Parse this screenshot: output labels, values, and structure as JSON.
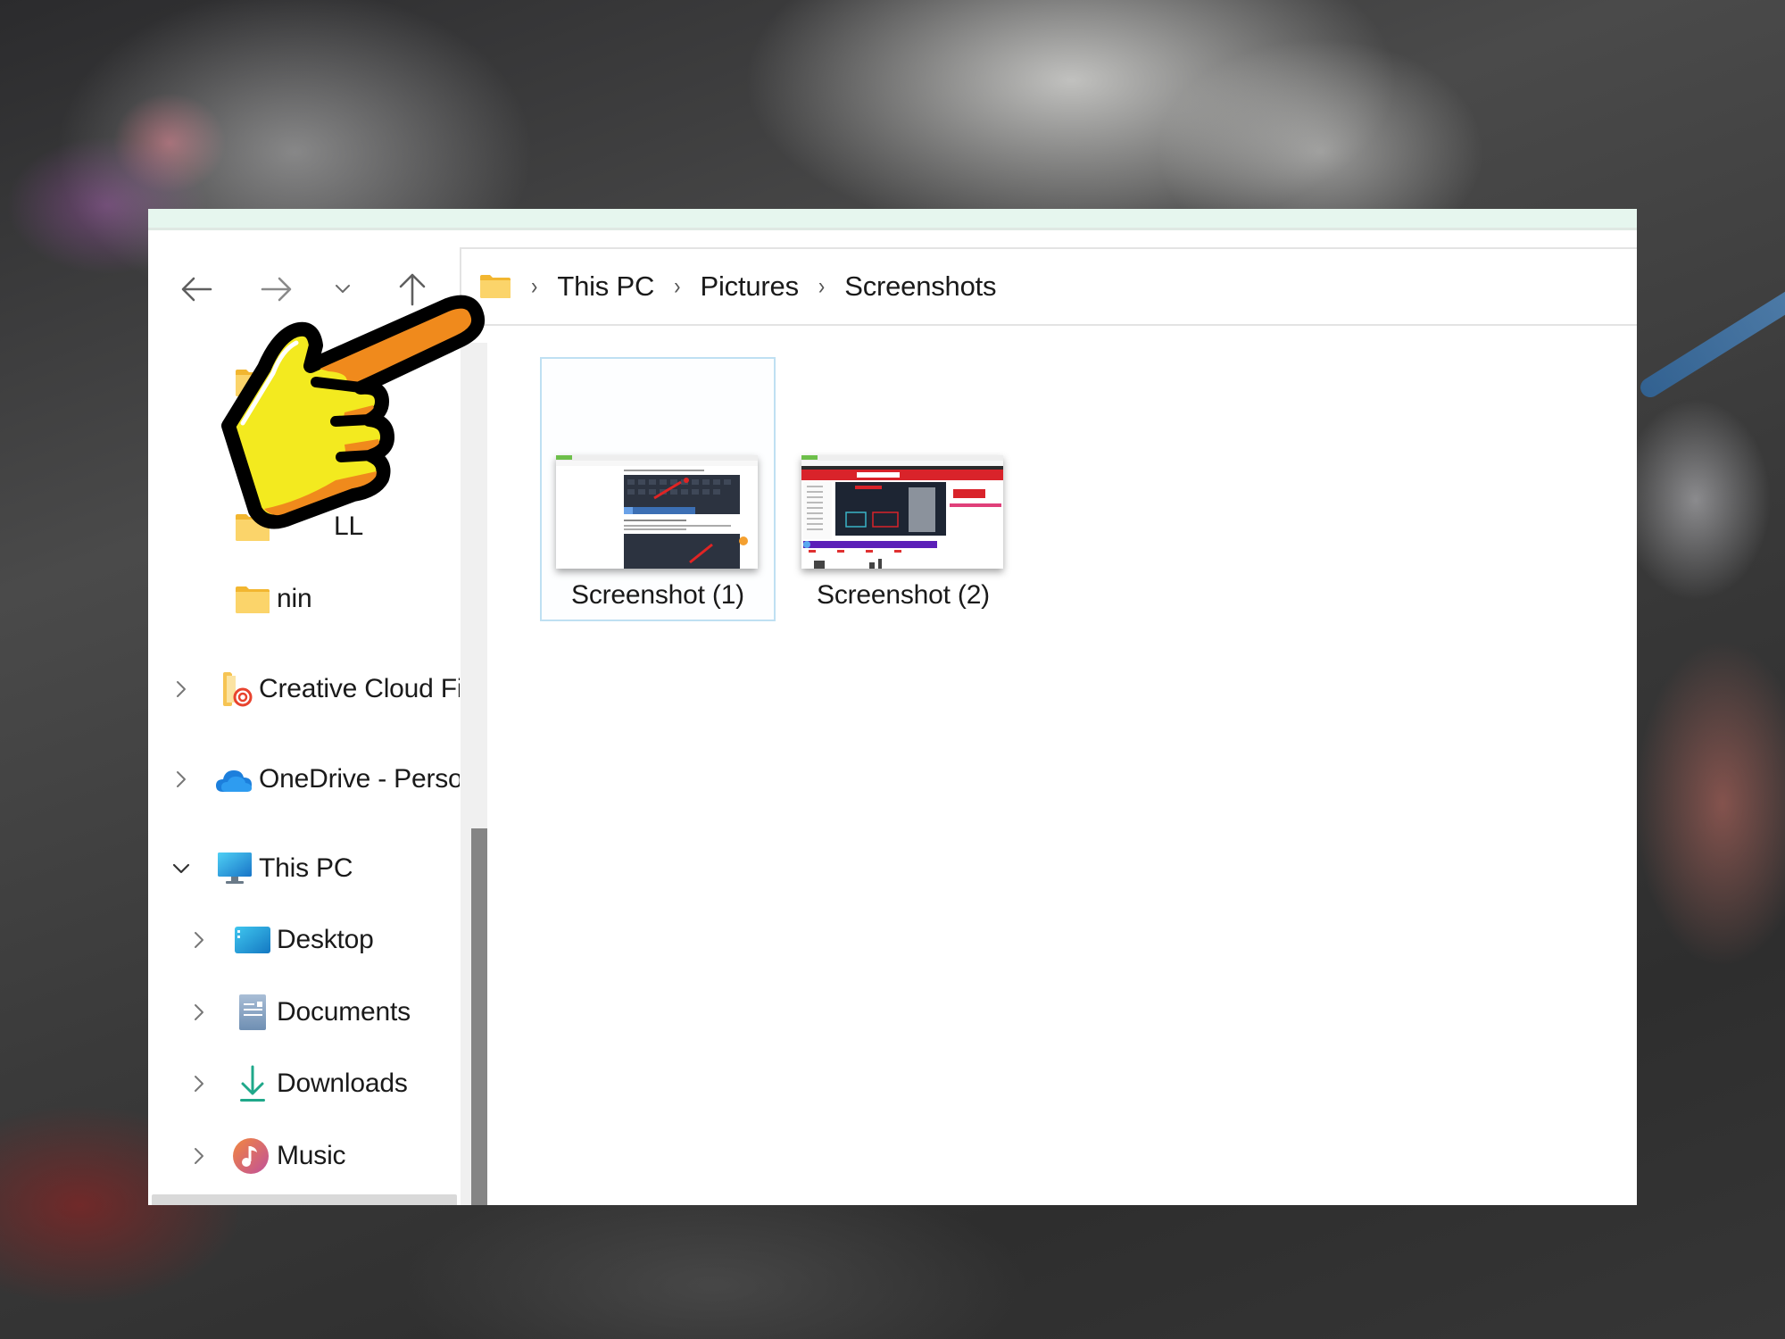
{
  "window": {
    "title_strip_color": "#e6f6ee"
  },
  "nav": {
    "back": {
      "icon": "arrow-left-icon",
      "label": "Back"
    },
    "forward": {
      "icon": "arrow-right-icon",
      "label": "Forward"
    },
    "recent": {
      "icon": "chevron-down-icon",
      "label": "Recent locations"
    },
    "up": {
      "icon": "arrow-up-icon",
      "label": "Up"
    }
  },
  "address_bar": {
    "icon": "folder-icon",
    "separator": "›",
    "crumbs": [
      "This PC",
      "Pictures",
      "Screenshots"
    ]
  },
  "sidebar": {
    "items": [
      {
        "label": "",
        "icon": "folder-icon",
        "indent": 2,
        "chevron": "none"
      },
      {
        "label": "LL",
        "icon": "folder-icon",
        "indent": 2,
        "chevron": "none"
      },
      {
        "label": "nin",
        "icon": "folder-icon",
        "indent": 2,
        "chevron": "none"
      },
      {
        "label": "Creative Cloud Fi",
        "icon": "creative-cloud-icon",
        "indent": 1,
        "chevron": "right"
      },
      {
        "label": "OneDrive - Perso",
        "icon": "onedrive-cloud-icon",
        "indent": 1,
        "chevron": "right"
      },
      {
        "label": "This PC",
        "icon": "monitor-icon",
        "indent": 1,
        "chevron": "down"
      },
      {
        "label": "Desktop",
        "icon": "desktop-icon",
        "indent": 2,
        "chevron": "right"
      },
      {
        "label": "Documents",
        "icon": "document-icon",
        "indent": 2,
        "chevron": "right"
      },
      {
        "label": "Downloads",
        "icon": "download-icon",
        "indent": 2,
        "chevron": "right"
      },
      {
        "label": "Music",
        "icon": "music-icon",
        "indent": 2,
        "chevron": "right"
      }
    ]
  },
  "files": [
    {
      "name": "Screenshot (1)",
      "selected": true,
      "thumbnail": "browser-article-keyboard"
    },
    {
      "name": "Screenshot (2)",
      "selected": false,
      "thumbnail": "browser-shop-red"
    }
  ],
  "overlay": {
    "icon": "pointing-hand-icon",
    "colors": {
      "fill": "#f3ea1f",
      "shade": "#f08a1c",
      "outline": "#000000"
    }
  },
  "colors": {
    "selection_border": "#bfe0f2",
    "folder_yellow": "#f8c94a",
    "scroll_thumb": "#858585"
  }
}
